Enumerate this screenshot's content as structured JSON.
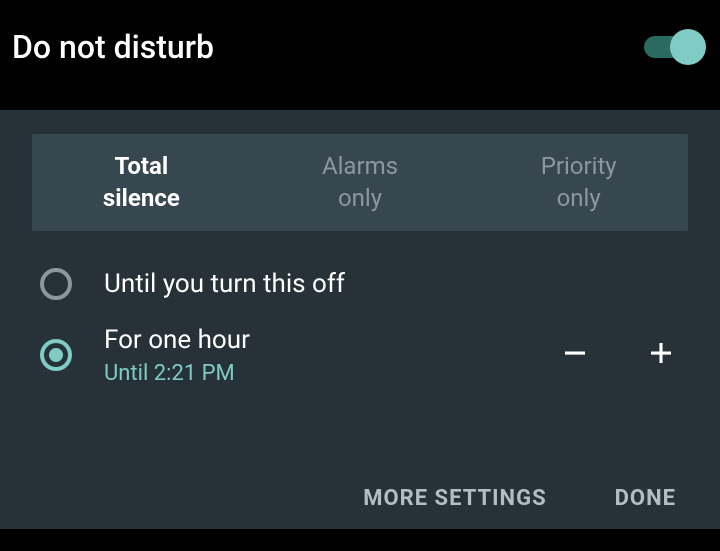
{
  "header": {
    "title": "Do not disturb",
    "toggle_on": true
  },
  "tabs": [
    {
      "label_line1": "Total",
      "label_line2": "silence",
      "selected": true
    },
    {
      "label_line1": "Alarms",
      "label_line2": "only",
      "selected": false
    },
    {
      "label_line1": "Priority",
      "label_line2": "only",
      "selected": false
    }
  ],
  "options": {
    "off": {
      "label": "Until you turn this off",
      "selected": false
    },
    "duration": {
      "label": "For one hour",
      "sublabel": "Until 2:21 PM",
      "selected": true
    }
  },
  "footer": {
    "more_settings": "MORE SETTINGS",
    "done": "DONE"
  },
  "colors": {
    "accent": "#80cbc4"
  }
}
